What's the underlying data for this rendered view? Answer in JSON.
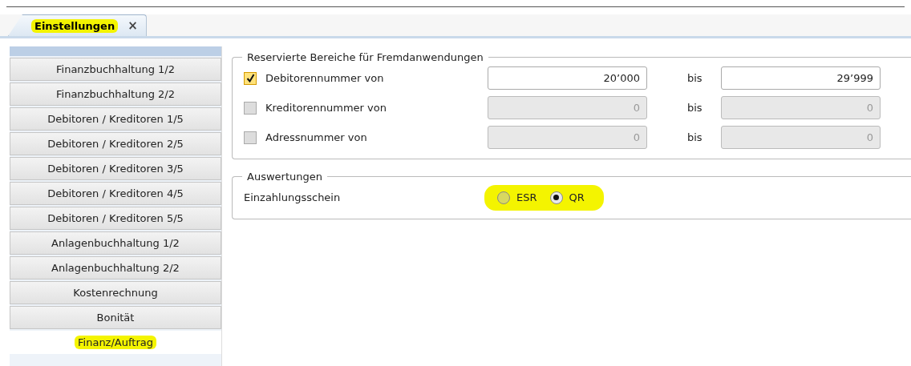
{
  "tab": {
    "label": "Einstellungen",
    "close": "×",
    "selected": true,
    "highlighted": true
  },
  "sidebar": {
    "items": [
      {
        "label": "Finanzbuchhaltung 1/2",
        "selected": false,
        "highlighted": false
      },
      {
        "label": "Finanzbuchhaltung 2/2",
        "selected": false,
        "highlighted": false
      },
      {
        "label": "Debitoren / Kreditoren 1/5",
        "selected": false,
        "highlighted": false
      },
      {
        "label": "Debitoren / Kreditoren 2/5",
        "selected": false,
        "highlighted": false
      },
      {
        "label": "Debitoren / Kreditoren 3/5",
        "selected": false,
        "highlighted": false
      },
      {
        "label": "Debitoren / Kreditoren 4/5",
        "selected": false,
        "highlighted": false
      },
      {
        "label": "Debitoren / Kreditoren 5/5",
        "selected": false,
        "highlighted": false
      },
      {
        "label": "Anlagenbuchhaltung 1/2",
        "selected": false,
        "highlighted": false
      },
      {
        "label": "Anlagenbuchhaltung 2/2",
        "selected": false,
        "highlighted": false
      },
      {
        "label": "Kostenrechnung",
        "selected": false,
        "highlighted": false
      },
      {
        "label": "Bonität",
        "selected": false,
        "highlighted": false
      },
      {
        "label": "Finanz/Auftrag",
        "selected": true,
        "highlighted": true
      }
    ]
  },
  "reserved": {
    "legend": "Reservierte Bereiche für Fremdanwendungen",
    "rows": [
      {
        "label": "Debitorennummer von",
        "checked": true,
        "from": "20’000",
        "to_label": "bis",
        "to": "29’999"
      },
      {
        "label": "Kreditorennummer von",
        "checked": false,
        "from": "0",
        "to_label": "bis",
        "to": "0"
      },
      {
        "label": "Adressnummer von",
        "checked": false,
        "from": "0",
        "to_label": "bis",
        "to": "0"
      }
    ]
  },
  "reports": {
    "legend": "Auswertungen",
    "label": "Einzahlungsschein",
    "highlighted": true,
    "options": [
      {
        "label": "ESR",
        "selected": false
      },
      {
        "label": "QR",
        "selected": true
      }
    ]
  }
}
